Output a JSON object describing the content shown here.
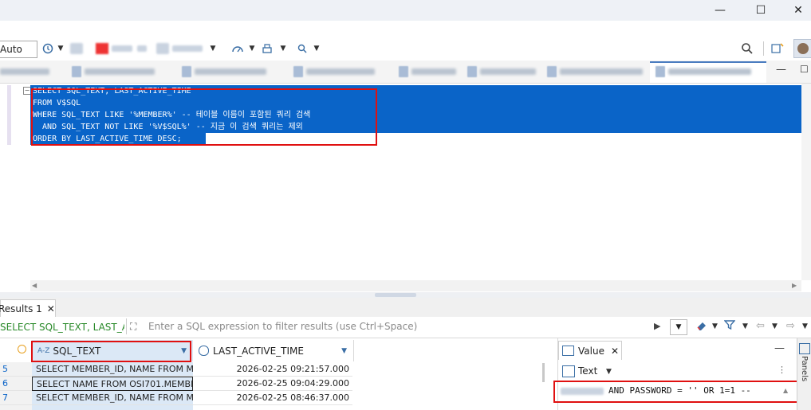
{
  "toolbar": {
    "transaction_mode": "Auto",
    "icons": [
      "history-icon",
      "commit-icon",
      "rollback-icon",
      "format-icon",
      "dashboard-icon",
      "export-icon",
      "search-icon"
    ]
  },
  "editor": {
    "code_lines": [
      "SELECT SQL_TEXT, LAST_ACTIVE_TIME",
      "FROM V$SQL",
      "WHERE SQL_TEXT LIKE '%MEMBER%' -- 테이블 이름이 포함된 쿼리 검색",
      "  AND SQL_TEXT NOT LIKE '%V$SQL%' -- 지금 이 검색 쿼리는 제외",
      "ORDER BY LAST_ACTIVE_TIME DESC;"
    ]
  },
  "results": {
    "tab_label": "Results 1",
    "filter_query": "SELECT SQL_TEXT, LAST_ACTI",
    "filter_placeholder": "Enter a SQL expression to filter results (use Ctrl+Space)",
    "columns": [
      "SQL_TEXT",
      "LAST_ACTIVE_TIME"
    ],
    "rows": [
      {
        "num": "5",
        "sql_text": "SELECT MEMBER_ID, NAME FROM M",
        "time": "2026-02-25 09:21:57.000"
      },
      {
        "num": "6",
        "sql_text": "SELECT NAME FROM OSI701.MEMBE",
        "time": "2026-02-25 09:04:29.000"
      },
      {
        "num": "7",
        "sql_text": "SELECT MEMBER_ID, NAME FROM M",
        "time": "2026-02-25 08:46:37.000"
      }
    ]
  },
  "value_panel": {
    "tab_label": "Value",
    "view_mode": "Text",
    "value_text": "AND PASSWORD = '' OR 1=1 --",
    "side_label": "Panels"
  },
  "colors": {
    "selection": "#0a64c8",
    "highlight_box": "#e01010",
    "row_cell": "#dbe8f6"
  }
}
